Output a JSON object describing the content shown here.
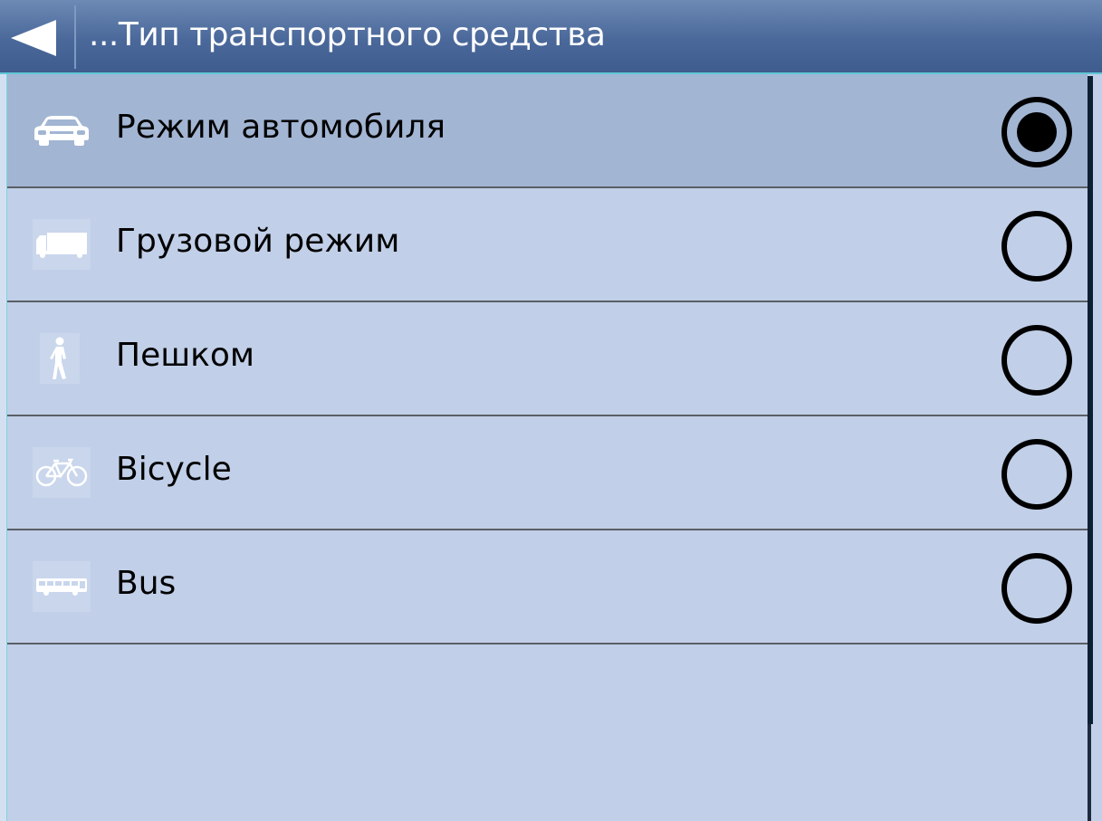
{
  "header": {
    "title": "...Тип транспортного средства",
    "back_icon": "back-arrow-icon"
  },
  "options": [
    {
      "label": "Режим автомобиля",
      "icon": "car-icon",
      "selected": true
    },
    {
      "label": "Грузовой режим",
      "icon": "truck-icon",
      "selected": false
    },
    {
      "label": "Пешком",
      "icon": "pedestrian-icon",
      "selected": false
    },
    {
      "label": "Bicycle",
      "icon": "bicycle-icon",
      "selected": false
    },
    {
      "label": "Bus",
      "icon": "bus-icon",
      "selected": false
    }
  ],
  "colors": {
    "header": "#4a689a",
    "list_bg": "#c1cfe8",
    "selected_row": "#a2b5d3",
    "accent": "#5fc7d6"
  }
}
